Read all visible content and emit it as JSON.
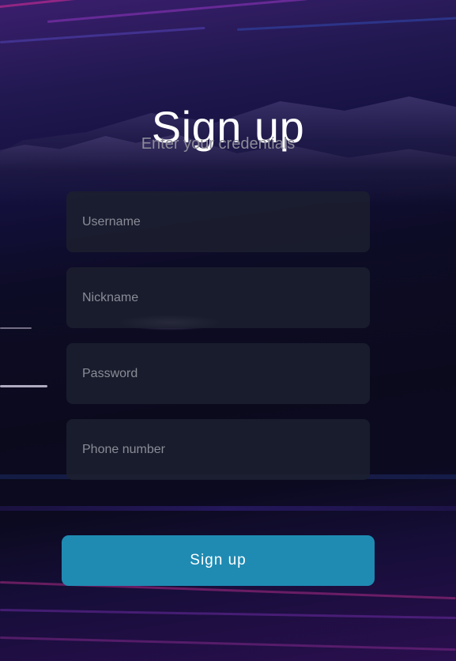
{
  "header": {
    "title": "Sign up",
    "subtitle": "Enter your credentials"
  },
  "form": {
    "fields": [
      {
        "placeholder": "Username",
        "value": ""
      },
      {
        "placeholder": "Nickname",
        "value": ""
      },
      {
        "placeholder": "Password",
        "value": ""
      },
      {
        "placeholder": "Phone number",
        "value": ""
      }
    ],
    "submit_label": "Sign up"
  },
  "colors": {
    "button": "#1f8bb3",
    "field_background": "#1c202e",
    "title": "#ffffff",
    "subtitle": "#8c8b98"
  }
}
